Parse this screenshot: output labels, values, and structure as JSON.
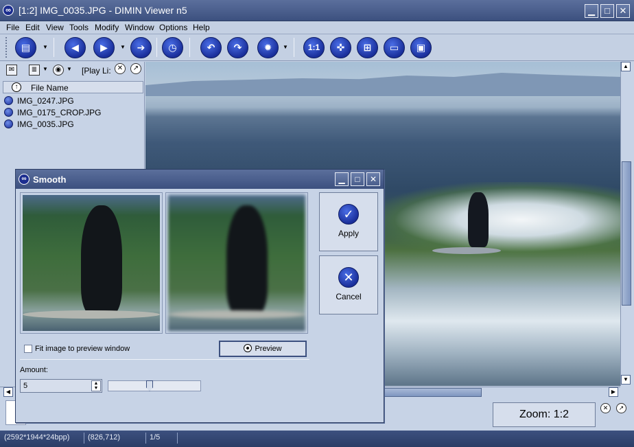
{
  "window": {
    "title": "[1:2] IMG_0035.JPG - DIMIN Viewer n5",
    "app_icon_glyph": "∞",
    "buttons": {
      "minimize": "▁",
      "maximize": "□",
      "close": "✕"
    }
  },
  "menu": [
    "File",
    "Edit",
    "View",
    "Tools",
    "Modify",
    "Window",
    "Options",
    "Help"
  ],
  "toolbar": {
    "icons": [
      "open-folder-icon",
      "back-arrow-icon",
      "play-icon",
      "forward-arrow-icon",
      "clock-icon",
      "rotate-left-icon",
      "rotate-right-icon",
      "gear-icon",
      "actual-size-icon",
      "fit-shrink-icon",
      "fit-expand-icon",
      "monitor-icon",
      "fullscreen-icon"
    ],
    "actual_size_label": "1:1"
  },
  "left_pane": {
    "title": "[Play Li:",
    "column_header": "File Name",
    "files": [
      "IMG_0247.JPG",
      "IMG_0175_CROP.JPG",
      "IMG_0035.JPG"
    ]
  },
  "dialog": {
    "title": "Smooth",
    "apply_label": "Apply",
    "cancel_label": "Cancel",
    "fit_checkbox_label": "Fit image to preview window",
    "fit_checked": false,
    "preview_label": "Preview",
    "amount_label": "Amount:",
    "amount_value": "5",
    "slider_fraction": 0.44
  },
  "zoom": {
    "label": "Zoom: 1:2"
  },
  "status": {
    "dimensions": "(2592*1944*24bpp)",
    "cursor": "(826,712)",
    "position": "1/5"
  },
  "colors": {
    "titlebar": "#3c507f",
    "accent_blue": "#1a2f9b",
    "panel_bg": "#c7d3e6"
  }
}
